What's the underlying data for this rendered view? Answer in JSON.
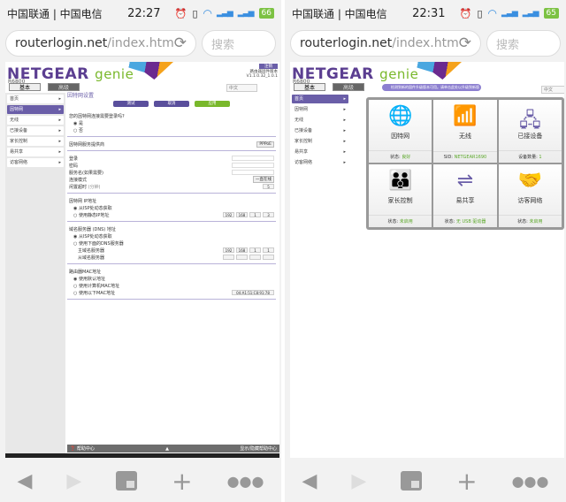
{
  "screens": [
    {
      "status": {
        "carrier": "中国联通 | 中国电信",
        "time": "22:27",
        "battery": "66"
      },
      "url": {
        "host": "routerlogin.net",
        "path": "/index.htm",
        "search_placeholder": "搜索"
      }
    },
    {
      "status": {
        "carrier": "中国联通 | 中国电信",
        "time": "22:31",
        "battery": "65"
      },
      "url": {
        "host": "routerlogin.net",
        "path": "/index.htm",
        "search_placeholder": "搜索"
      }
    }
  ],
  "brand": {
    "name": "NETGEAR",
    "genie": "genie",
    "model": "R6800"
  },
  "tabs": {
    "basic": "基本",
    "advanced": "高级"
  },
  "lang": "中文",
  "firmware": {
    "update": "注销",
    "label": "路由器固件版本",
    "version": "V1.1.0.32_1.0.1"
  },
  "sidebar": [
    "首页",
    "因特网",
    "无线",
    "已接设备",
    "家长控制",
    "易共享",
    "访客网络"
  ],
  "internet": {
    "title": "因特网设置",
    "buttons": {
      "test": "测试",
      "cancel": "取消",
      "apply": "应用"
    },
    "q": "您的因特网连接需要登录吗?",
    "yes": "是",
    "no": "否",
    "provider": "因特网服务提供商",
    "provider_value": "PPPoE",
    "login": "登录",
    "password": "密码",
    "service": "服务名(如果需要)",
    "conn_mode": "连接模式",
    "conn_value": "一直在线",
    "idle": "闲置超时",
    "idle_unit": "(分钟)",
    "idle_value": "5",
    "ip_title": "因特网 IP地址",
    "ip_auto": "从ISP处动态获取",
    "ip_static": "使用静态IP地址",
    "ip_vals": [
      "192",
      "168",
      "1",
      "3"
    ],
    "dns_title": "域名服务器 (DNS) 地址",
    "dns_auto": "从ISP处动态获取",
    "dns_manual": "使用下面的DNS服务器",
    "dns_primary": "主域名服务器",
    "dns_secondary": "从域名服务器",
    "dns_vals": [
      "192",
      "168",
      "1",
      "1"
    ],
    "mac_title": "路由器MAC地址",
    "mac_default": "使用默认地址",
    "mac_computer": "使用计算机MAC地址",
    "mac_this": "使用以下MAC地址",
    "mac_value": "04:A1:51:C8:91:78",
    "help": "帮助中心",
    "help_right": "显示/隐藏帮助中心"
  },
  "home": {
    "notice": "检测到新的固件升级版本可用。请单击此处以升级到新版本。",
    "tiles": [
      {
        "title": "因特网",
        "status_label": "状态:",
        "status": "良好",
        "icon": "globe-icon"
      },
      {
        "title": "无线",
        "status_label": "SID:",
        "status": "NETGEAR1690",
        "icon": "wifi-icon"
      },
      {
        "title": "已接设备",
        "status_label": "设备数量:",
        "status": "1",
        "icon": "devices-icon"
      },
      {
        "title": "家长控制",
        "status_label": "状态:",
        "status": "未启用",
        "icon": "family-icon"
      },
      {
        "title": "易共享",
        "status_label": "状态:",
        "status": "无 USB 驱动器",
        "icon": "usb-icon"
      },
      {
        "title": "访客网络",
        "status_label": "状态:",
        "status": "未启用",
        "icon": "guest-icon"
      }
    ]
  }
}
